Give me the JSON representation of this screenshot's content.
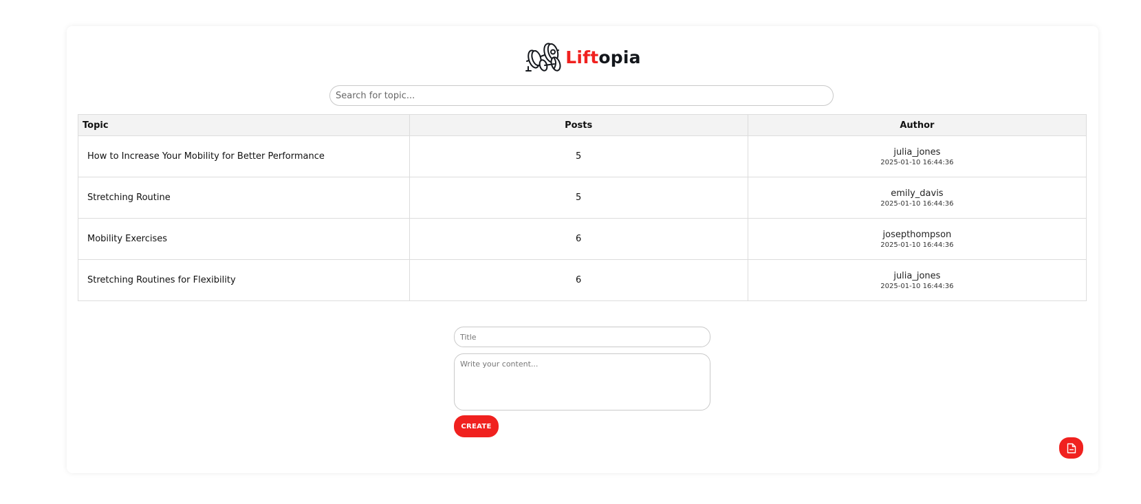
{
  "brand": {
    "name_accent": "Lift",
    "name_rest": "opia",
    "logo_icon": "barbell-icon",
    "accent_color": "#f0211f"
  },
  "search": {
    "placeholder": "Search for topic...",
    "value": ""
  },
  "table": {
    "headers": {
      "topic": "Topic",
      "posts": "Posts",
      "author": "Author"
    },
    "rows": [
      {
        "topic": "How to Increase Your Mobility for Better Performance",
        "posts": "5",
        "author": "julia_jones",
        "date": "2025-01-10 16:44:36"
      },
      {
        "topic": "Stretching Routine",
        "posts": "5",
        "author": "emily_davis",
        "date": "2025-01-10 16:44:36"
      },
      {
        "topic": "Mobility Exercises",
        "posts": "6",
        "author": "josepthompson",
        "date": "2025-01-10 16:44:36"
      },
      {
        "topic": "Stretching Routines for Flexibility",
        "posts": "6",
        "author": "julia_jones",
        "date": "2025-01-10 16:44:36"
      }
    ]
  },
  "form": {
    "title_placeholder": "Title",
    "content_placeholder": "Write your content...",
    "create_label": "CREATE"
  },
  "fab": {
    "icon": "document-icon"
  }
}
